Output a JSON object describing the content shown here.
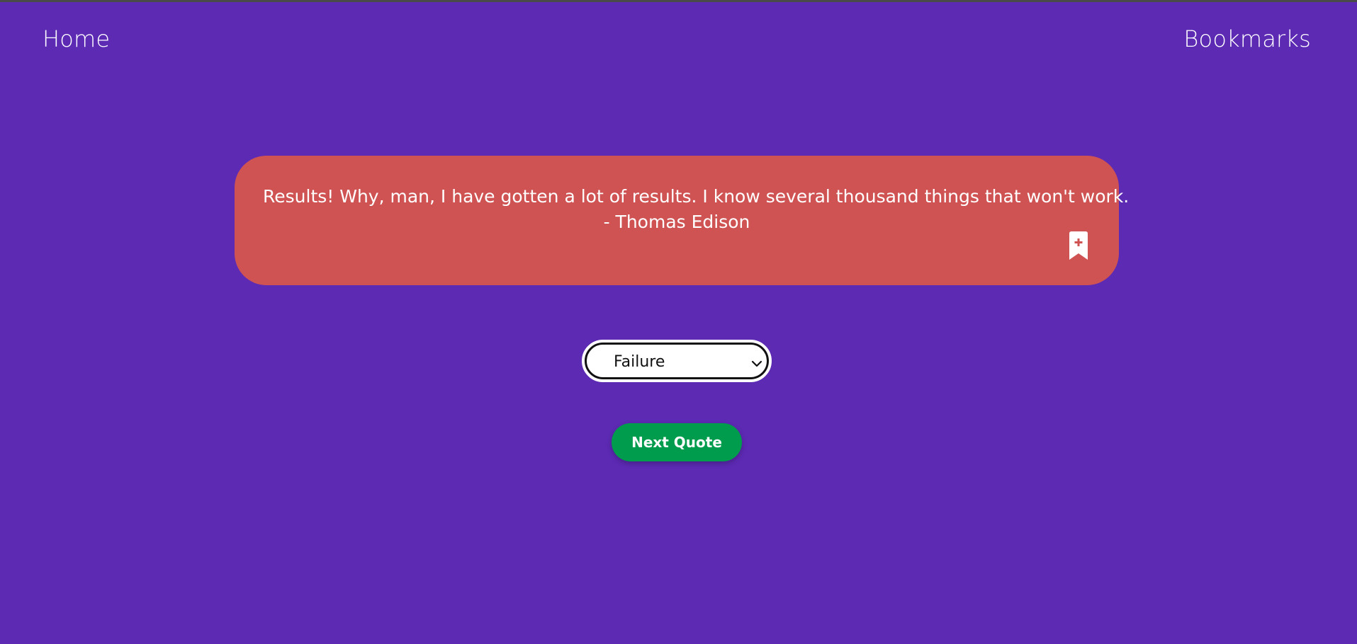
{
  "colors": {
    "background": "#5d2ab4",
    "card": "#d05353",
    "button": "#009c4e",
    "text": "#ffffff"
  },
  "nav": {
    "home_label": "Home",
    "bookmarks_label": "Bookmarks"
  },
  "quote": {
    "text": "Results! Why, man, I have gotten a lot of results. I know several thousand things that won't work.",
    "author": "- Thomas Edison",
    "bookmark_icon": "bookmark-add-icon"
  },
  "category_select": {
    "selected": "Failure",
    "icon": "chevron-down-icon"
  },
  "next_button": {
    "label": "Next Quote"
  }
}
